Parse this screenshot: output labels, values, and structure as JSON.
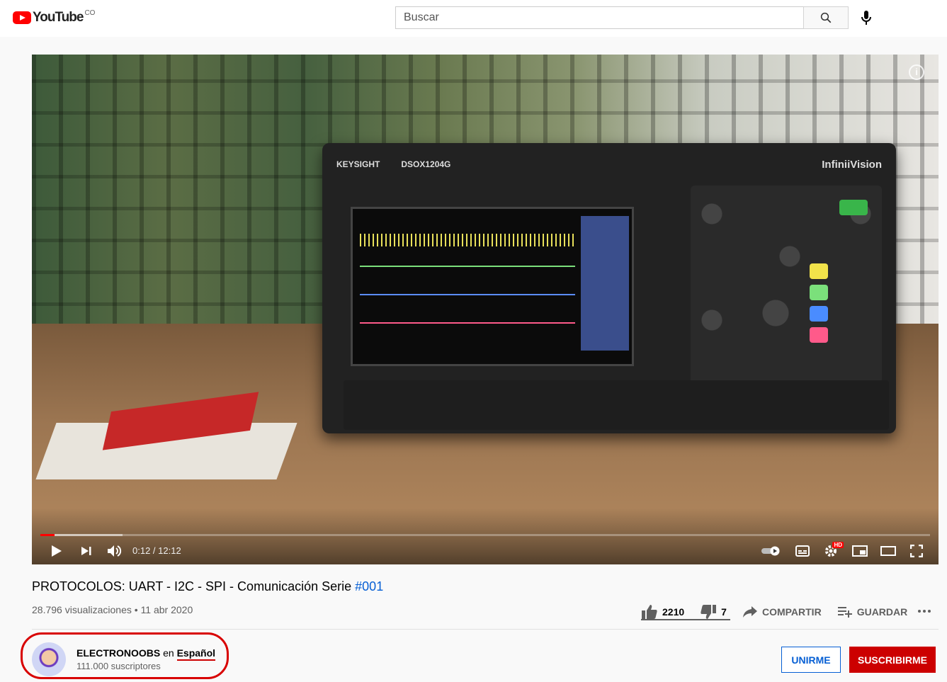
{
  "header": {
    "logo_text": "YouTube",
    "country_code": "CO",
    "search_placeholder": "Buscar"
  },
  "player": {
    "time_current": "0:12",
    "time_separator": " / ",
    "time_total": "12:12",
    "played_fraction": 0.016,
    "buffered_fraction": 0.092,
    "info_label": "i",
    "hd_badge": "HD",
    "scope_brand": "KEYSIGHT",
    "scope_model": "DSOX1204G",
    "scope_series": "InfiniiVision"
  },
  "video": {
    "title": "PROTOCOLOS: UART - I2C - SPI - Comunicación Serie",
    "hashtag": "#001",
    "views": "28.796 visualizaciones",
    "separator": " • ",
    "date": "11 abr 2020"
  },
  "actions": {
    "likes": "2210",
    "dislikes": "7",
    "share": "COMPARTIR",
    "save": "GUARDAR",
    "like_ratio": 0.997
  },
  "channel": {
    "name": "ELECTRONOOBS",
    "name_connector": "en",
    "name_language": "Español",
    "subscribers": "111.000 suscriptores",
    "join": "UNIRME",
    "subscribe": "SUSCRIBIRME"
  },
  "colors": {
    "accent_red": "#cc0000",
    "link_blue": "#065fd4",
    "progress_red": "#ff0000"
  }
}
